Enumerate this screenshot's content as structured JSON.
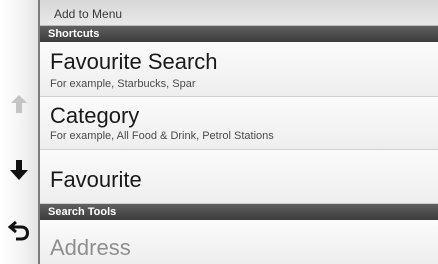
{
  "menu": {
    "add_to_menu": "Add to Menu"
  },
  "sections": {
    "shortcuts": "Shortcuts",
    "search_tools": "Search Tools"
  },
  "items": [
    {
      "title": "Favourite Search",
      "subtitle": "For example, Starbucks, Spar",
      "enabled": true
    },
    {
      "title": "Category",
      "subtitle": "For example, All Food & Drink, Petrol Stations",
      "enabled": true
    },
    {
      "title": "Favourite",
      "subtitle": "",
      "enabled": true
    },
    {
      "title": "Address",
      "subtitle": "",
      "enabled": false
    }
  ],
  "rail": {
    "up_icon": "arrow-up-icon",
    "up_enabled": false,
    "down_icon": "arrow-down-icon",
    "down_enabled": true,
    "back_icon": "back-arrow-icon"
  },
  "colors": {
    "header_bg": "#4a4a4a",
    "header_text": "#ffffff",
    "item_text": "#1a1a1a",
    "disabled_text": "#8f8f8f",
    "disabled_icon": "#bdbdbd"
  }
}
